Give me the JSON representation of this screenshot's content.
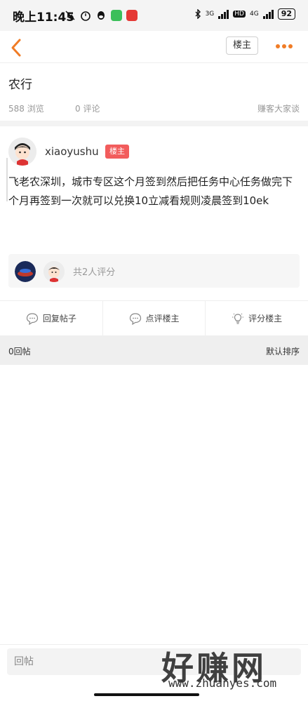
{
  "status": {
    "time": "晚上11:45",
    "net1": "3G",
    "hd": "HD",
    "net2": "4G",
    "battery": "92"
  },
  "header": {
    "owner_button": "楼主"
  },
  "post": {
    "title": "农行",
    "views": "588 浏览",
    "comments": "0 评论",
    "source": "赚客大家谈",
    "author": "xiaoyushu",
    "author_badge": "楼主",
    "content": "飞老农深圳，城市专区这个月签到然后把任务中心任务做完下个月再签到一次就可以兑换10立减看规则凌晨签到10ek",
    "rating_summary": "共2人评分"
  },
  "actions": {
    "reply_post": "回复帖子",
    "comment_owner": "点评楼主",
    "rate_owner": "评分楼主"
  },
  "replies": {
    "count": "0回帖",
    "sort": "默认排序"
  },
  "bottom": {
    "reply_placeholder": "回帖",
    "watermark": "好赚网",
    "watermark_url": "www.zhuanyes.com"
  },
  "colors": {
    "accent": "#f07c26",
    "badge": "#f25c5c"
  },
  "icons": {
    "back": "chevron-left-icon",
    "more": "more-dots-icon",
    "reply": "chat-bubble-icon",
    "comment": "chat-bubble-icon",
    "rate": "lightbulb-icon"
  }
}
